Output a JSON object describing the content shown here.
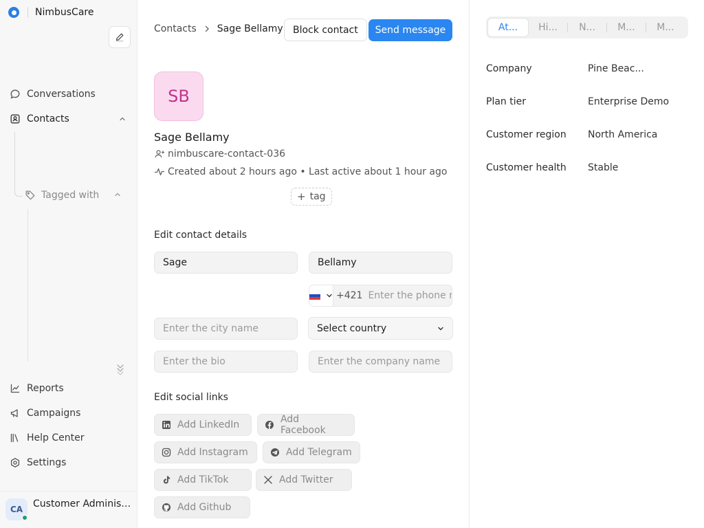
{
  "app": {
    "name": "NimbusCare"
  },
  "sidebar": {
    "items": [
      {
        "label": "Conversations"
      },
      {
        "label": "Contacts"
      }
    ],
    "tagged_label": "Tagged with",
    "bottom_items": [
      {
        "label": "Reports"
      },
      {
        "label": "Campaigns"
      },
      {
        "label": "Help Center"
      },
      {
        "label": "Settings"
      }
    ],
    "user": {
      "initials": "CA",
      "name": "Customer Administrator"
    }
  },
  "header": {
    "breadcrumb_root": "Contacts",
    "breadcrumb_current": "Sage Bellamy",
    "block_label": "Block contact",
    "send_label": "Send message"
  },
  "contact": {
    "initials": "SB",
    "name": "Sage Bellamy",
    "handle": "nimbuscare-contact-036",
    "activity": "Created about 2 hours ago • Last active about 1 hour ago",
    "tag_label": "tag"
  },
  "form": {
    "title": "Edit contact details",
    "first_name": "Sage",
    "last_name": "Bellamy",
    "phone_code": "+421",
    "phone_placeholder": "Enter the phone number",
    "city_placeholder": "Enter the city name",
    "country_value": "Select country",
    "bio_placeholder": "Enter the bio",
    "company_placeholder": "Enter the company name"
  },
  "social": {
    "title": "Edit social links",
    "linkedin": "Add LinkedIn",
    "facebook": "Add Facebook",
    "instagram": "Add Instagram",
    "telegram": "Add Telegram",
    "tiktok": "Add TikTok",
    "twitter": "Add Twitter",
    "github": "Add Github"
  },
  "right_panel": {
    "tabs": [
      "At...",
      "Hi...",
      "N...",
      "M...",
      "M..."
    ],
    "attributes": [
      {
        "label": "Company",
        "value": "Pine Beac..."
      },
      {
        "label": "Plan tier",
        "value": "Enterprise Demo"
      },
      {
        "label": "Customer region",
        "value": "North America"
      },
      {
        "label": "Customer health",
        "value": "Stable"
      }
    ]
  },
  "colors": {
    "accent": "#2a86f0",
    "avatar_bg": "#fbdaf0",
    "avatar_fg": "#c0338b",
    "status_online": "#1f9d74"
  }
}
